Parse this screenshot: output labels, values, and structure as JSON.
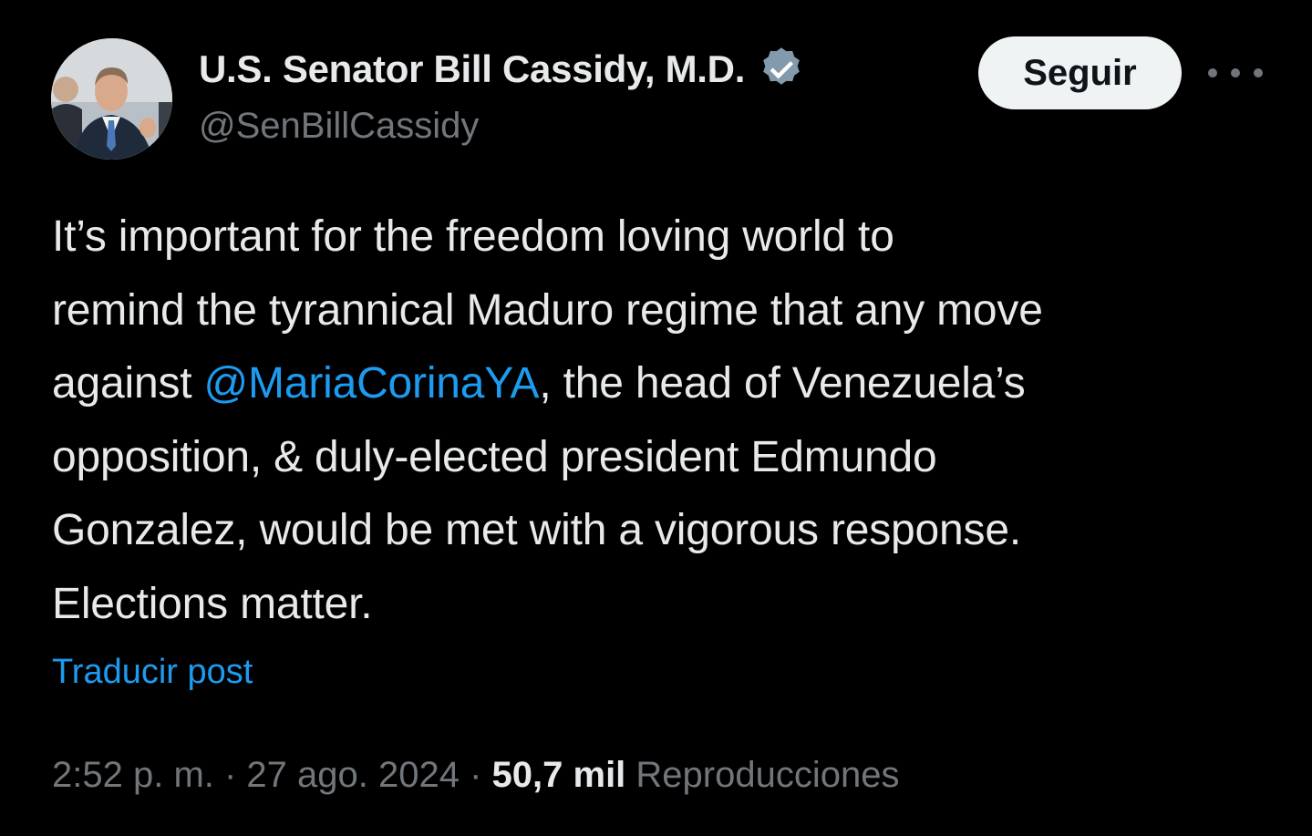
{
  "author": {
    "display_name": "U.S. Senator Bill Cassidy, M.D.",
    "handle": "@SenBillCassidy",
    "verified_icon": "verified-badge-icon",
    "verified_color": "#829aab"
  },
  "actions": {
    "follow_label": "Seguir",
    "more_icon": "more-options-icon"
  },
  "tweet": {
    "line1": "It’s important for the freedom loving world to",
    "line2": "remind the tyrannical Maduro regime that any move",
    "line3_before": "against ",
    "mention": "@MariaCorinaYA",
    "line3_after": ", the head of Venezuela’s",
    "line4": "opposition, & duly-elected president Edmundo",
    "line5": "Gonzalez, would be met with a vigorous response.",
    "line6": "Elections matter."
  },
  "translate_label": "Traducir post",
  "meta": {
    "time": "2:52 p. m.",
    "separator": " · ",
    "date": "27 ago. 2024",
    "views_count": "50,7 mil",
    "views_label": "Reproducciones"
  },
  "colors": {
    "background": "#000000",
    "text": "#e7e9ea",
    "secondary": "#71767b",
    "link": "#1d9bf0",
    "button_bg": "#eff3f4"
  }
}
